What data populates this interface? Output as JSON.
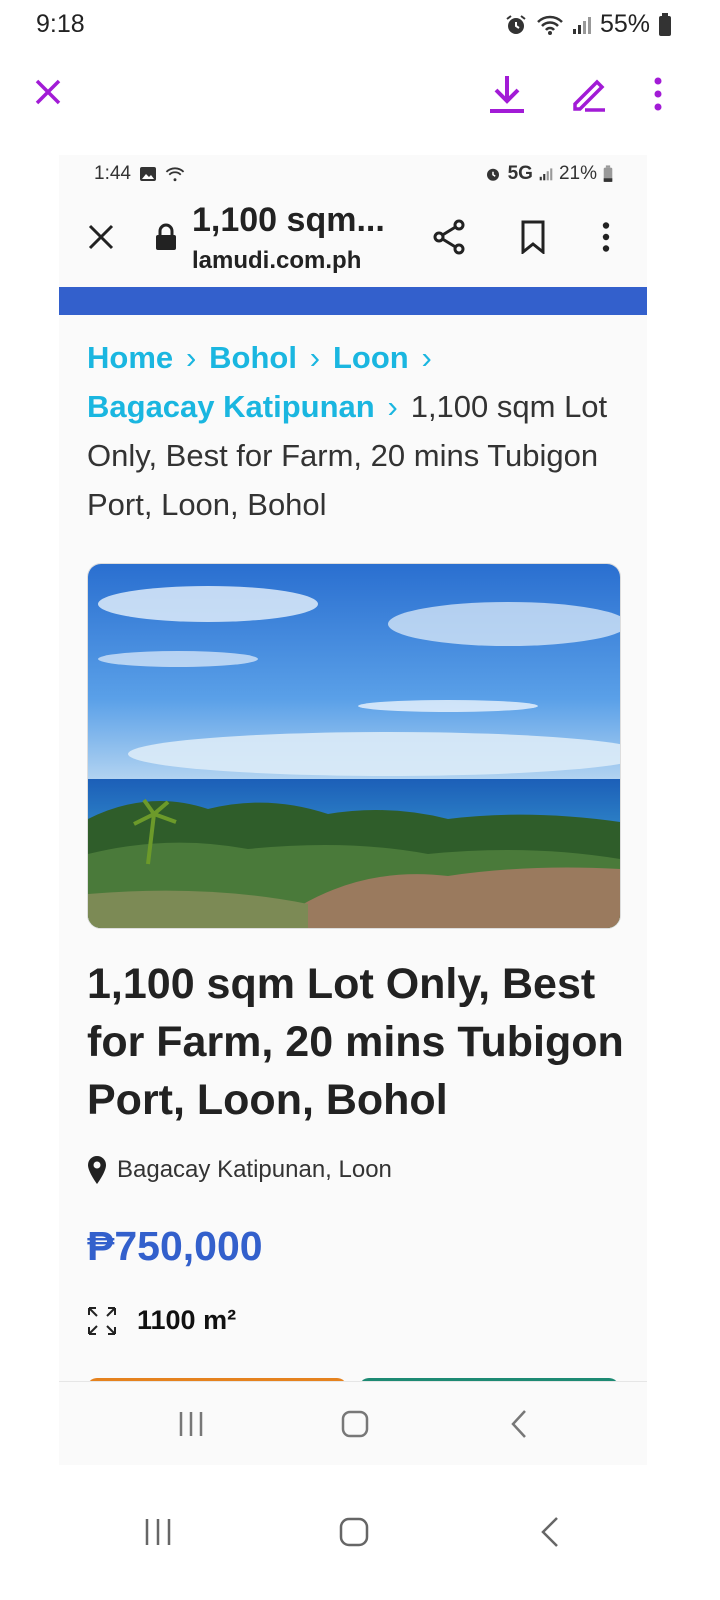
{
  "os_status": {
    "time": "9:18",
    "battery": "55%"
  },
  "viewer_toolbar": {
    "close_icon": "close-icon",
    "download_icon": "download-icon",
    "edit_icon": "pen-icon",
    "more_icon": "kebab-icon"
  },
  "screenshot": {
    "status": {
      "time": "1:44",
      "network": "5G",
      "battery": "21%"
    },
    "address_bar": {
      "title": "1,100 sqm...",
      "url": "lamudi.com.ph"
    },
    "breadcrumbs": {
      "links": [
        "Home",
        "Bohol",
        "Loon",
        "Bagacay Katipunan"
      ],
      "current": "1,100 sqm Lot Only, Best for Farm, 20 mins Tubigon Port, Loon, Bohol"
    },
    "listing": {
      "title": "1,100 sqm Lot Only, Best for Farm, 20 mins Tubigon Port, Loon, Bohol",
      "location": "Bagacay Katipunan, Loon",
      "price": "₱750,000",
      "area": "1100 m²"
    },
    "colors": {
      "accent_blue": "#3360cc",
      "link_cyan": "#1ab6e0",
      "orange_button": "#e5821e",
      "green_button": "#1d8a73"
    }
  },
  "accent_purple": "#a21bd6"
}
